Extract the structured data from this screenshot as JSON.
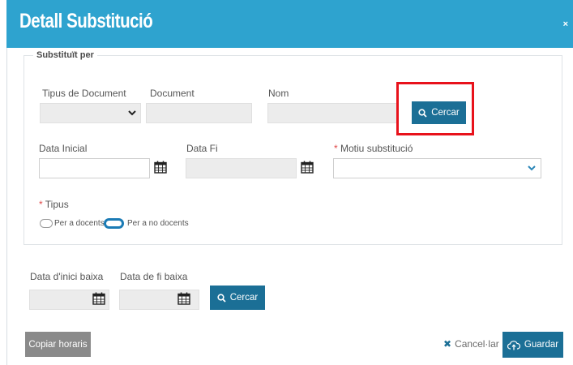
{
  "dialog": {
    "title": "Detall Substitució",
    "close_label": "×"
  },
  "substitute": {
    "legend": "Substituït per",
    "doc_type_label": "Tipus de Document",
    "doc_type_value": "",
    "document_label": "Document",
    "document_value": "",
    "name_label": "Nom",
    "name_value": "",
    "search_label": "Cercar",
    "start_date_label": "Data Inicial",
    "start_date_value": "",
    "end_date_label": "Data Fi",
    "end_date_value": "",
    "reason_required_mark": "*",
    "reason_label": "Motiu substitució",
    "reason_value": "",
    "type_required_mark": "*",
    "type_label": "Tipus",
    "type_option_teachers": "Per a docents",
    "type_option_non_teachers": "Per a no docents"
  },
  "leave": {
    "start_label": "Data d'inici baixa",
    "start_value": "",
    "end_label": "Data de fi baixa",
    "end_value": "",
    "search_label": "Cercar"
  },
  "footer": {
    "copy_schedules": "Copiar horaris",
    "cancel": "Cancel·lar",
    "save": "Guardar"
  },
  "icons": {
    "search": "search-icon",
    "calendar": "calendar-icon",
    "chevron": "chevron-down-icon",
    "cancel": "close-icon",
    "save": "cloud-upload-icon"
  },
  "colors": {
    "header": "#2ea3cf",
    "primary_button": "#1b6f96",
    "secondary_button": "#8a8a8a",
    "highlight": "#e8121b",
    "required": "#e04848"
  }
}
